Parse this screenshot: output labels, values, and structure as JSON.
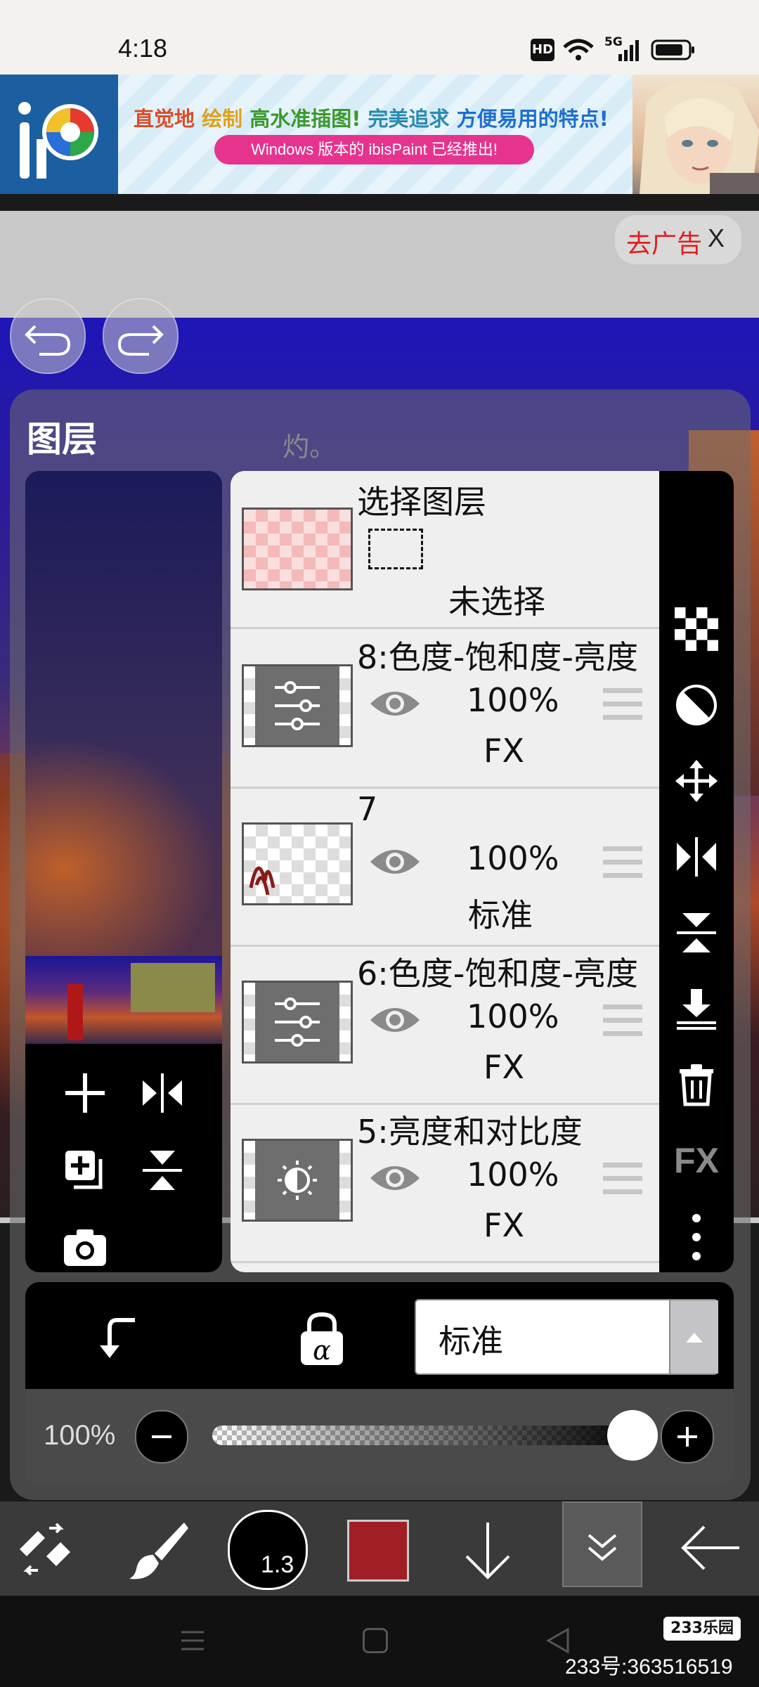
{
  "status": {
    "time": "4:18",
    "hd": "HD",
    "net": "5G"
  },
  "ad": {
    "logo_text": "iP",
    "headline_parts": [
      {
        "text": "直觉地 ",
        "color": "#d94e2a"
      },
      {
        "text": "绘制 ",
        "color": "#e0a21a"
      },
      {
        "text": "高水准插图! ",
        "color": "#3a9a2a"
      },
      {
        "text": "完美追求 ",
        "color": "#2a8ab0"
      },
      {
        "text": "方便易用的特点!",
        "color": "#1c6ed0"
      }
    ],
    "pill_text": "Windows 版本的 ibisPaint 已经推出!",
    "remove_label": "去广告",
    "close_label": "X"
  },
  "panel": {
    "title": "图层",
    "watermark": "灼。"
  },
  "select_layer": {
    "title": "选择图层",
    "status": "未选择"
  },
  "layers": [
    {
      "name": "8:色度-饱和度-亮度",
      "opacity": "100%",
      "mode": "FX",
      "kind": "adjust-sliders"
    },
    {
      "name": "7",
      "opacity": "100%",
      "mode": "标准",
      "kind": "drawing"
    },
    {
      "name": "6:色度-饱和度-亮度",
      "opacity": "100%",
      "mode": "FX",
      "kind": "adjust-sliders"
    },
    {
      "name": "5:亮度和对比度",
      "opacity": "100%",
      "mode": "FX",
      "kind": "adjust-brightness"
    }
  ],
  "right_tools": [
    "checkerboard-icon",
    "invert-icon",
    "move-icon",
    "flip-horizontal-icon",
    "flip-vertical-icon",
    "merge-down-icon",
    "trash-icon",
    "fx-icon",
    "more-icon"
  ],
  "right_fx_label": "FX",
  "blend": {
    "value": "标准"
  },
  "opacity": {
    "label": "100%",
    "value": 1.0
  },
  "toolbar": {
    "brush_size": "1.3",
    "color": "#a01e24"
  },
  "watermark_site": {
    "logo": "233乐园",
    "id": "233号:363516519"
  }
}
